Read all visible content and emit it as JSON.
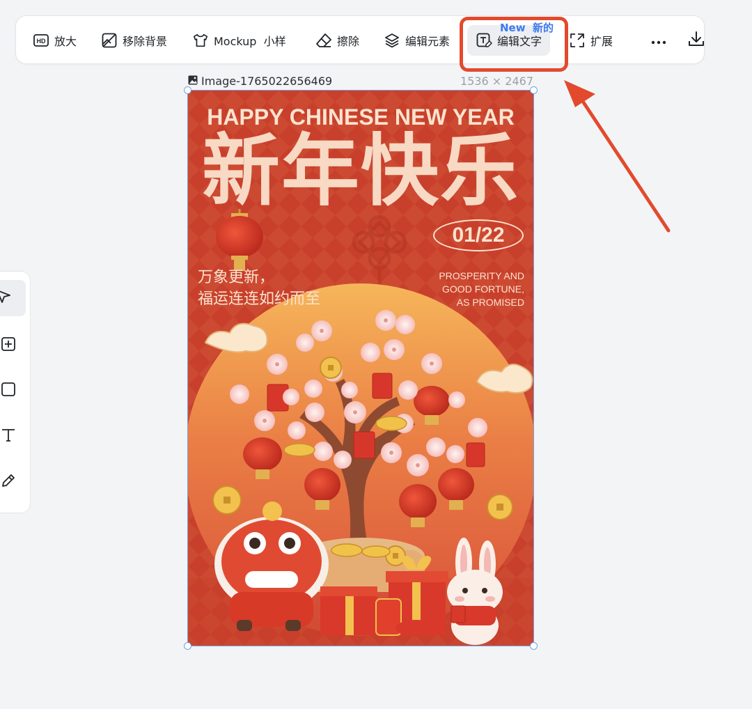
{
  "toolbar": {
    "items": [
      {
        "label": "放大",
        "icon": "hd-icon"
      },
      {
        "label": "移除背景",
        "icon": "remove-background-icon"
      },
      {
        "label": "Mockup  小样",
        "icon": "tshirt-icon"
      },
      {
        "label": "擦除",
        "icon": "eraser-icon"
      },
      {
        "label": "编辑元素",
        "icon": "layers-icon"
      },
      {
        "label": "编辑文字",
        "icon": "edit-text-icon",
        "active": true
      },
      {
        "label": "扩展",
        "icon": "expand-icon"
      }
    ],
    "new_badge": "New  新的",
    "more_icon": "more-icon",
    "download_icon": "download-icon"
  },
  "image": {
    "name": "Image-1765022656469",
    "dimensions": "1536 × 2467"
  },
  "poster": {
    "headline_en": "HAPPY CHINESE NEW YEAR",
    "headline_cn": "新年快乐",
    "date": "01/22",
    "tagline_cn_1": "万象更新，",
    "tagline_cn_2": "福运连连如约而至",
    "tagline_en": [
      "PROSPERITY AND",
      "GOOD FORTUNE,",
      "AS PROMISED"
    ]
  },
  "rail": {
    "items": [
      "select-arrow-icon",
      "add-frame-icon",
      "rectangle-icon",
      "text-icon",
      "pen-icon"
    ]
  },
  "colors": {
    "highlight": "#e24a2e",
    "badge": "#3d7bf0",
    "poster_red": "#c8402b",
    "selection": "#6fa2e8"
  }
}
